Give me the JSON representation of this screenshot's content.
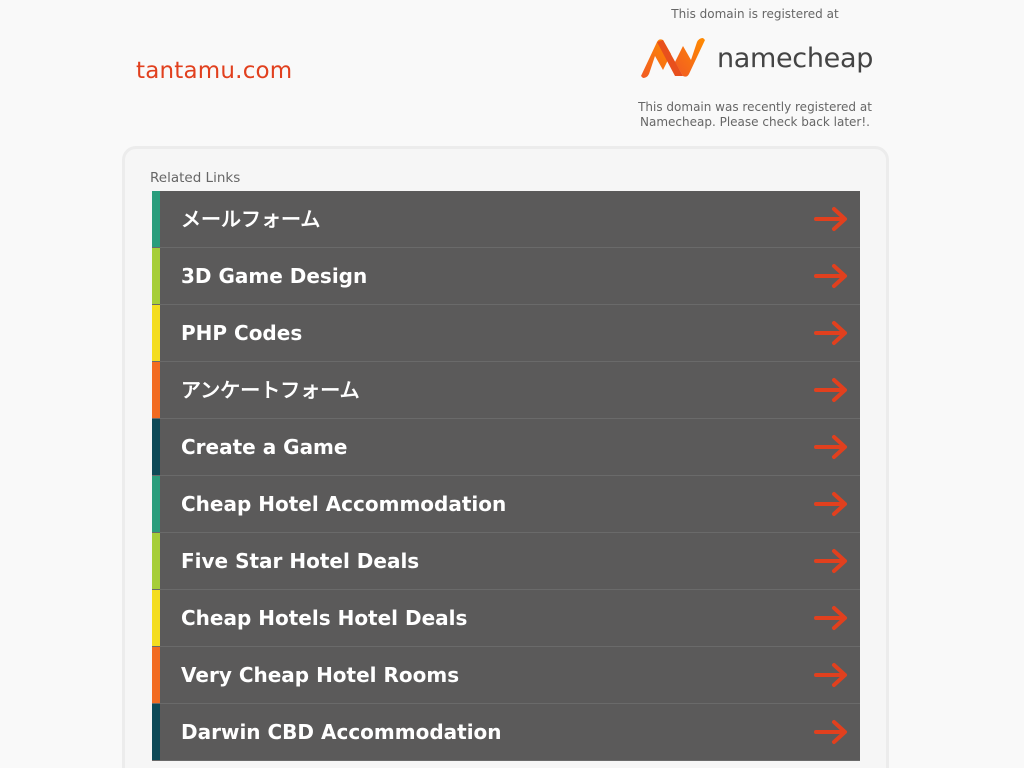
{
  "header": {
    "domain": "tantamu.com",
    "registered_at_text": "This domain is registered at",
    "registrar_name": "namecheap",
    "registered_note_line1": "This domain was recently registered at",
    "registered_note_line2": "Namecheap. Please check back later!."
  },
  "colors": {
    "domain_text": "#e1401e",
    "row_background": "#5b5a5a",
    "arrow": "#e1401e",
    "logo_gradient": [
      "#f15a24",
      "#ff8c00"
    ]
  },
  "related": {
    "title": "Related Links",
    "items": [
      {
        "label": "メールフォーム",
        "accent": "#2a9d7c",
        "icon": "arrow-right-icon"
      },
      {
        "label": "3D Game Design",
        "accent": "#a6ce39",
        "icon": "arrow-right-icon"
      },
      {
        "label": "PHP Codes",
        "accent": "#f4dd1f",
        "icon": "arrow-right-icon"
      },
      {
        "label": "アンケートフォーム",
        "accent": "#f26b21",
        "icon": "arrow-right-icon"
      },
      {
        "label": "Create a Game",
        "accent": "#0e4a57",
        "icon": "arrow-right-icon"
      },
      {
        "label": "Cheap Hotel Accommodation",
        "accent": "#2a9d7c",
        "icon": "arrow-right-icon"
      },
      {
        "label": "Five Star Hotel Deals",
        "accent": "#a6ce39",
        "icon": "arrow-right-icon"
      },
      {
        "label": "Cheap Hotels Hotel Deals",
        "accent": "#f4dd1f",
        "icon": "arrow-right-icon"
      },
      {
        "label": "Very Cheap Hotel Rooms",
        "accent": "#f26b21",
        "icon": "arrow-right-icon"
      },
      {
        "label": "Darwin CBD Accommodation",
        "accent": "#0e4a57",
        "icon": "arrow-right-icon"
      }
    ]
  }
}
